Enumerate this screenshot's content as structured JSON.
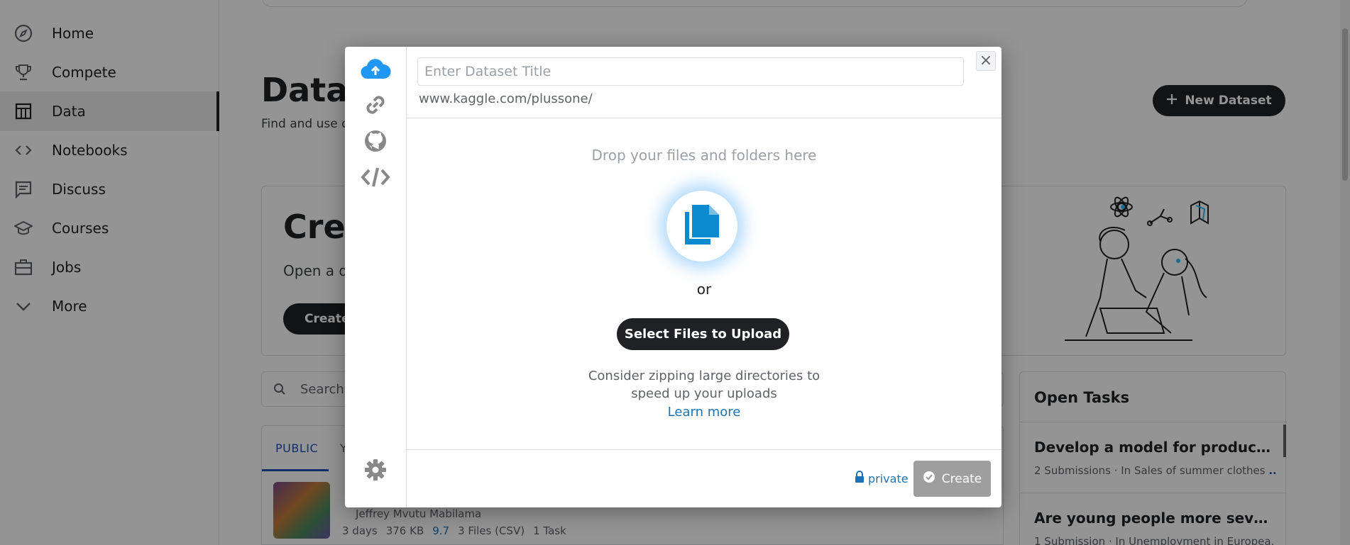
{
  "sidebar": {
    "items": [
      {
        "label": "Home",
        "icon": "compass-icon"
      },
      {
        "label": "Compete",
        "icon": "trophy-icon"
      },
      {
        "label": "Data",
        "icon": "table-icon",
        "active": true
      },
      {
        "label": "Notebooks",
        "icon": "code-icon"
      },
      {
        "label": "Discuss",
        "icon": "comment-icon"
      },
      {
        "label": "Courses",
        "icon": "graduation-cap-icon"
      },
      {
        "label": "Jobs",
        "icon": "briefcase-icon"
      },
      {
        "label": "More",
        "icon": "chevron-down-icon"
      }
    ]
  },
  "page": {
    "title": "Datas",
    "subtitle": "Find and use d",
    "new_dataset_label": "New Dataset"
  },
  "create_card": {
    "title": "Crea",
    "subtitle": "Open a d",
    "button_label": "Create"
  },
  "search": {
    "placeholder": "Search"
  },
  "tabs": {
    "public_label": "PUBLIC",
    "your_label": "Y"
  },
  "dataset_row": {
    "author": "Jeffrey Mvutu Mabilama",
    "age": "3 days",
    "size": "376 KB",
    "usability": "9.7",
    "files": "3 Files (CSV)",
    "tasks": "1 Task"
  },
  "open_tasks": {
    "title": "Open Tasks",
    "tasks": [
      {
        "name": "Develop a model for product suc...",
        "meta": "2 Submissions · In Sales of summer clothes",
        "more": "..."
      },
      {
        "name": "Are young people more severely...",
        "meta": "1 Submission · In Unemployment in Europea..."
      }
    ]
  },
  "modal": {
    "title_placeholder": "Enter Dataset Title",
    "title_value": "",
    "url_prefix": "www.kaggle.com/plussone/",
    "close_label": "×",
    "drop_title": "Drop your files and folders here",
    "or_label": "or",
    "select_label": "Select Files to Upload",
    "hint_line1": "Consider zipping large directories to",
    "hint_line2": "speed up your uploads",
    "learn_more_label": "Learn more",
    "privacy_label": "private",
    "create_label": "Create",
    "rail": [
      "cloud-upload-icon",
      "link-icon",
      "github-icon",
      "code-tag-icon",
      "gear-icon"
    ]
  },
  "colors": {
    "accent_blue": "#1a73b8",
    "cloud_blue": "#2196f3",
    "dark_button": "#202124",
    "disabled_button": "#9e9e9e"
  }
}
